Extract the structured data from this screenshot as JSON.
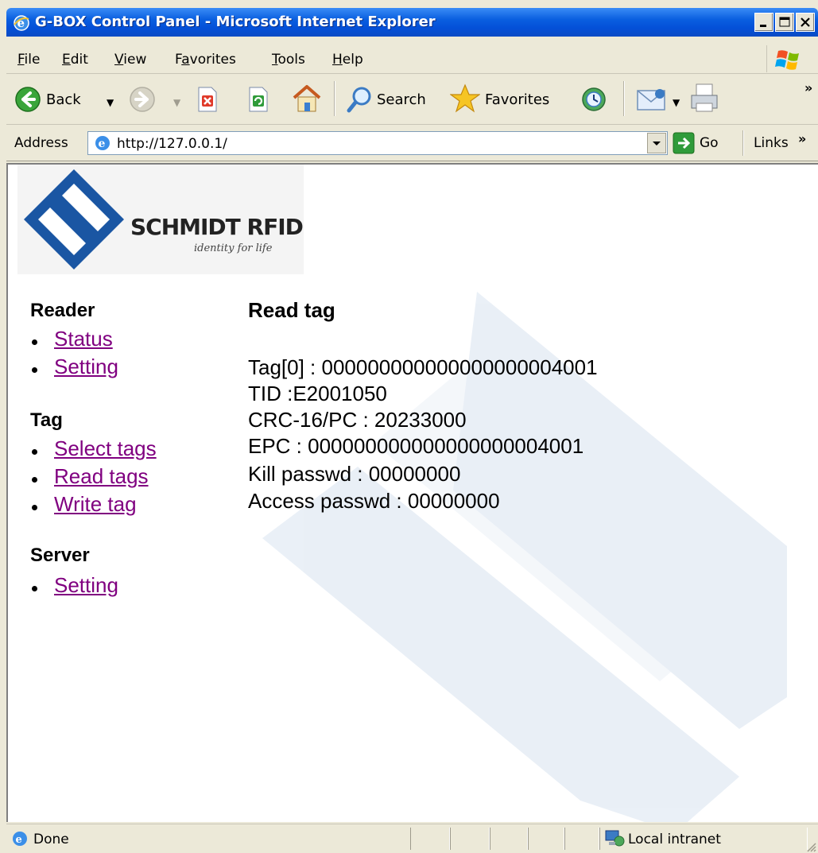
{
  "window": {
    "title": "G-BOX Control Panel - Microsoft Internet Explorer"
  },
  "menu": {
    "items": [
      {
        "label": "File",
        "accel": "F"
      },
      {
        "label": "Edit",
        "accel": "E"
      },
      {
        "label": "View",
        "accel": "V"
      },
      {
        "label": "Favorites",
        "accel": "a"
      },
      {
        "label": "Tools",
        "accel": "T"
      },
      {
        "label": "Help",
        "accel": "H"
      }
    ]
  },
  "toolbar": {
    "back_label": "Back",
    "search_label": "Search",
    "favorites_label": "Favorites",
    "overflow": "»"
  },
  "address": {
    "label": "Address",
    "url": "http://127.0.0.1/",
    "go_label": "Go",
    "links_label": "Links",
    "links_overflow": "»"
  },
  "logo": {
    "name": "SCHMIDT RFID",
    "tagline": "identity for life"
  },
  "nav": {
    "reader": {
      "heading": "Reader",
      "links": [
        "Status",
        "Setting"
      ]
    },
    "tag": {
      "heading": "Tag",
      "links": [
        "Select tags",
        "Read tags",
        "Write tag"
      ]
    },
    "server": {
      "heading": "Server",
      "links": [
        "Setting"
      ]
    }
  },
  "content": {
    "heading": "Read tag",
    "lines": [
      "Tag[0] : 000000000000000000004001",
      "TID :E2001050",
      "CRC-16/PC : 20233000",
      "EPC : 000000000000000000004001",
      "Kill passwd : 00000000",
      "Access passwd : 00000000"
    ]
  },
  "status": {
    "text": "Done",
    "zone": "Local intranet"
  },
  "colors": {
    "title_bar": "#0a5fe0",
    "visited_link": "#800080",
    "chrome": "#ece9d8",
    "logo_blue": "#1656a6"
  }
}
